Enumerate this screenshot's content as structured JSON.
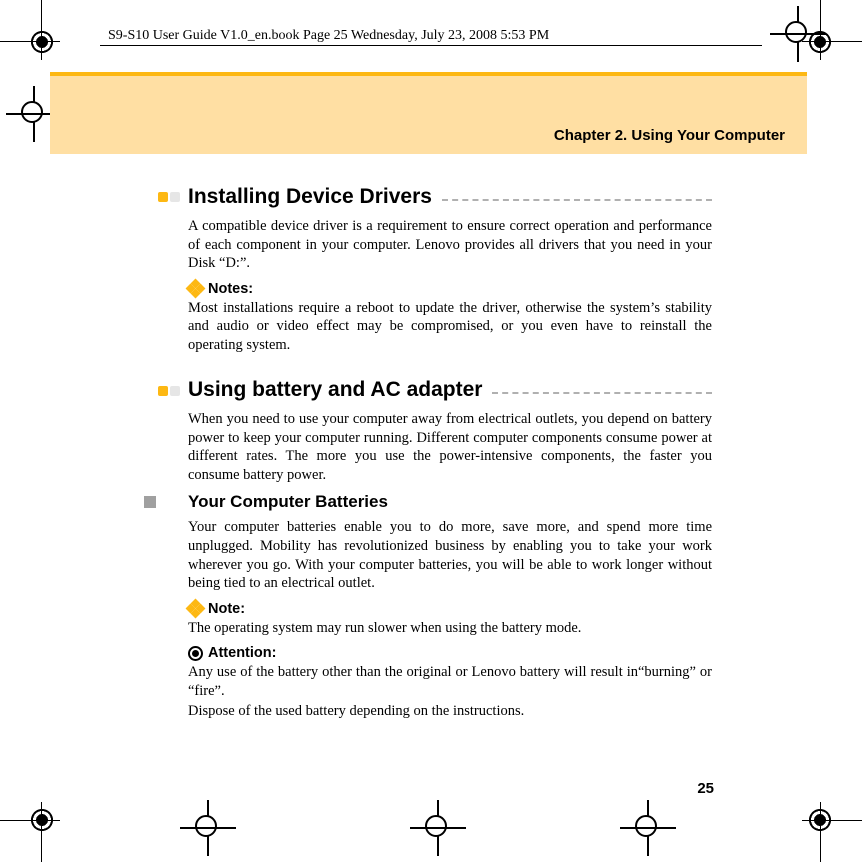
{
  "header": {
    "running_title": "S9-S10 User Guide V1.0_en.book  Page 25  Wednesday, July 23, 2008  5:53 PM"
  },
  "banner": {
    "chapter_title": "Chapter 2. Using Your Computer"
  },
  "sections": {
    "drivers": {
      "title": "Installing Device Drivers",
      "body": "A compatible device driver is a requirement to ensure correct operation and performance of each component in your computer. Lenovo provides all drivers that you need in your Disk “D:”.",
      "notes_label": "Notes:",
      "notes_body": "Most installations require a reboot to update the driver, otherwise the system’s stability and audio or video effect may be compromised, or you even have to reinstall the operating system."
    },
    "battery": {
      "title": "Using battery and AC adapter",
      "body": "When you need to use your computer away from electrical outlets, you depend on battery power to keep your computer running. Different computer components consume power at different rates. The more you use the power-intensive components, the faster you consume battery power."
    },
    "your_batteries": {
      "title": "Your Computer Batteries",
      "body": "Your computer batteries enable you to do more, save more, and spend more time unplugged. Mobility has revolutionized business by enabling you to take your work wherever you go. With your computer batteries, you will be able to work longer without being tied to an electrical outlet.",
      "note_label": "Note:",
      "note_body": "The operating system may run slower when using the battery mode.",
      "attention_label": "Attention:",
      "attention_body1": "Any use of the battery other than the original or Lenovo battery will result in“burning” or “fire”.",
      "attention_body2": "Dispose of the used battery depending on the instructions."
    }
  },
  "page_number": "25"
}
